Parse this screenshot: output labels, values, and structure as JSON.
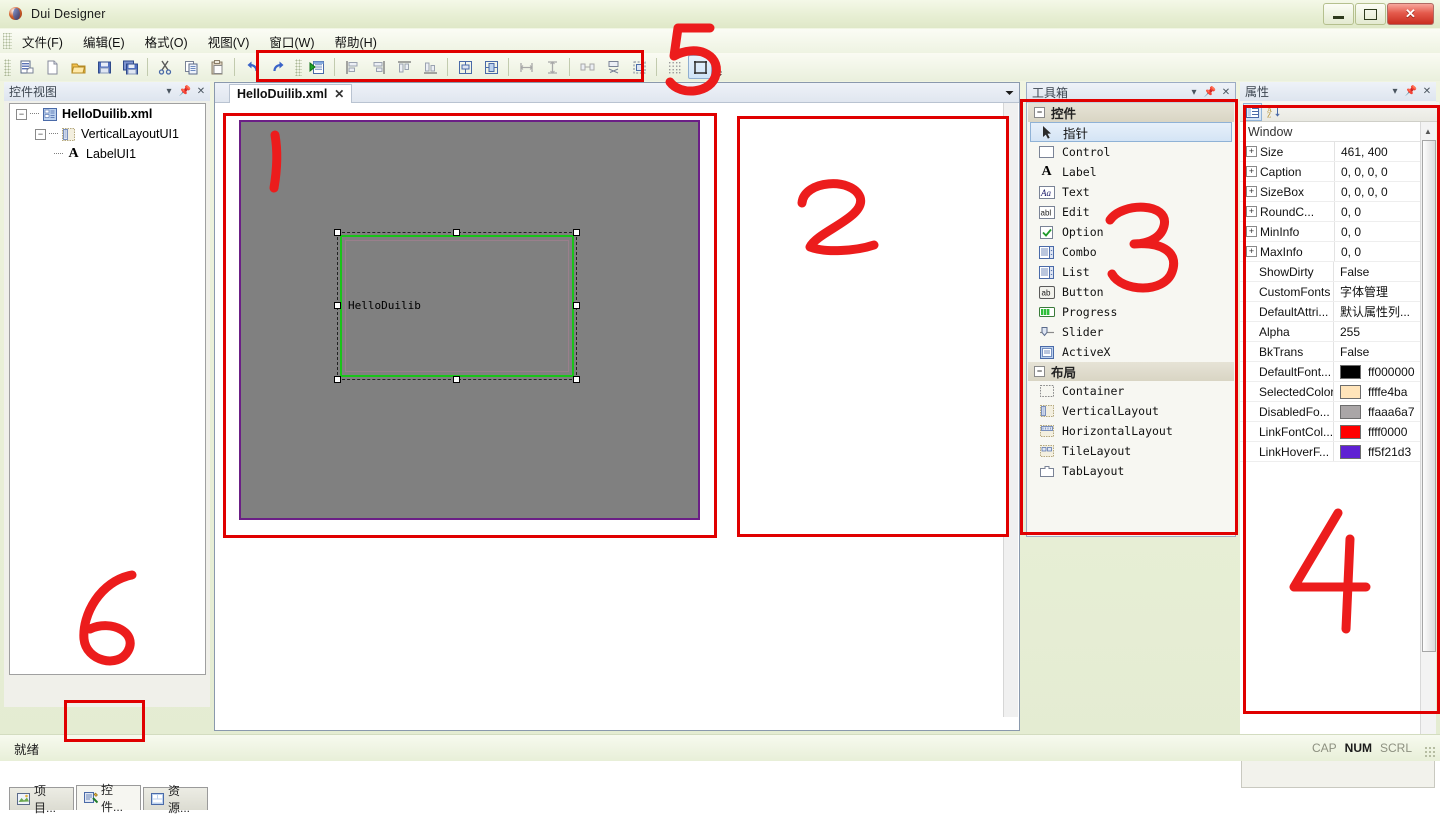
{
  "window": {
    "title": "Dui Designer",
    "app_icon": "dui-app-icon",
    "buttons": {
      "minimize": "minimize-icon",
      "restore": "restore-icon",
      "close": "close-icon"
    }
  },
  "menubar": {
    "items": [
      {
        "label": "文件(F)",
        "name": "menu-file"
      },
      {
        "label": "编辑(E)",
        "name": "menu-edit"
      },
      {
        "label": "格式(O)",
        "name": "menu-format"
      },
      {
        "label": "视图(V)",
        "name": "menu-view"
      },
      {
        "label": "窗口(W)",
        "name": "menu-window"
      },
      {
        "label": "帮助(H)",
        "name": "menu-help"
      }
    ]
  },
  "toolbar": {
    "groups": [
      [
        "new-doc",
        "new-file",
        "open",
        "save",
        "save-all"
      ],
      [
        "cut",
        "copy",
        "paste"
      ],
      [
        "undo",
        "redo"
      ]
    ],
    "format_group": [
      "test-run",
      "align-left",
      "align-right",
      "align-top",
      "align-bottom",
      "center-horizontal",
      "center-vertical",
      "same-width",
      "same-height",
      "space-horizontal",
      "space-vertical",
      "size-to-grid",
      "show-grid",
      "tab-order"
    ],
    "overflow": "toolbar-overflow-chevron"
  },
  "left_panel": {
    "title": "控件视图",
    "header_buttons": [
      "dropdown-icon",
      "pin-icon",
      "close-icon"
    ],
    "tree": [
      {
        "label": "HelloDuilib.xml",
        "level": 1,
        "icon": "xml-document-icon",
        "expanded": true,
        "bold": true
      },
      {
        "label": "VerticalLayoutUI1",
        "level": 2,
        "icon": "vertical-layout-icon",
        "expanded": true,
        "bold": false
      },
      {
        "label": "LabelUI1",
        "level": 3,
        "icon": "label-icon",
        "expanded": false,
        "bold": false
      }
    ],
    "tabs": [
      {
        "label": "项目...",
        "icon": "project-icon",
        "selected": false
      },
      {
        "label": "控件...",
        "icon": "controls-icon",
        "selected": true
      },
      {
        "label": "资源...",
        "icon": "resource-icon",
        "selected": false
      }
    ]
  },
  "editor": {
    "tab": {
      "label": "HelloDuilib.xml",
      "close": "✕"
    },
    "tab_dropdown": "chevron-down-icon",
    "design": {
      "surface_size": "461, 400",
      "selected_control_text": "HelloDuilib",
      "border_color": "#6b1f86",
      "background_color": "#808080",
      "selection_color": "#19c419",
      "handle_count": 8
    }
  },
  "toolbox": {
    "title": "工具箱",
    "header_buttons": [
      "dropdown-icon",
      "pin-icon",
      "close-icon"
    ],
    "categories": [
      {
        "name": "控件",
        "expanded": true,
        "items": [
          {
            "label": "指针",
            "icon": "pointer-icon",
            "selected": true,
            "cn": true
          },
          {
            "label": "Control",
            "icon": "control-icon",
            "selected": false,
            "cn": false
          },
          {
            "label": "Label",
            "icon": "label-a-icon",
            "selected": false,
            "cn": false
          },
          {
            "label": "Text",
            "icon": "text-aa-icon",
            "selected": false,
            "cn": false
          },
          {
            "label": "Edit",
            "icon": "edit-abl-icon",
            "selected": false,
            "cn": false
          },
          {
            "label": "Option",
            "icon": "option-check-icon",
            "selected": false,
            "cn": false
          },
          {
            "label": "Combo",
            "icon": "combo-icon",
            "selected": false,
            "cn": false
          },
          {
            "label": "List",
            "icon": "list-icon",
            "selected": false,
            "cn": false
          },
          {
            "label": "Button",
            "icon": "button-ab-icon",
            "selected": false,
            "cn": false
          },
          {
            "label": "Progress",
            "icon": "progress-icon",
            "selected": false,
            "cn": false
          },
          {
            "label": "Slider",
            "icon": "slider-icon",
            "selected": false,
            "cn": false
          },
          {
            "label": "ActiveX",
            "icon": "activex-icon",
            "selected": false,
            "cn": false
          }
        ]
      },
      {
        "name": "布局",
        "expanded": true,
        "items": [
          {
            "label": "Container",
            "icon": "container-icon",
            "selected": false,
            "cn": false
          },
          {
            "label": "VerticalLayout",
            "icon": "vertical-layout-icon",
            "selected": false,
            "cn": false
          },
          {
            "label": "HorizontalLayout",
            "icon": "horizontal-layout-icon",
            "selected": false,
            "cn": false
          },
          {
            "label": "TileLayout",
            "icon": "tile-layout-icon",
            "selected": false,
            "cn": false
          },
          {
            "label": "TabLayout",
            "icon": "tab-layout-icon",
            "selected": false,
            "cn": false
          }
        ]
      }
    ]
  },
  "properties": {
    "title": "属性",
    "header_buttons": [
      "dropdown-icon",
      "pin-icon",
      "close-icon"
    ],
    "tools": [
      {
        "name": "categorized-button",
        "icon": "categorized-icon",
        "active": true
      },
      {
        "name": "alphabetical-button",
        "icon": "alphabetical-sort-icon",
        "active": false
      }
    ],
    "section": "Window",
    "rows": [
      {
        "name": "Size",
        "value": "461, 400",
        "expandable": true,
        "swatch": null
      },
      {
        "name": "Caption",
        "value": "0, 0, 0, 0",
        "expandable": true,
        "swatch": null
      },
      {
        "name": "SizeBox",
        "value": "0, 0, 0, 0",
        "expandable": true,
        "swatch": null
      },
      {
        "name": "RoundC...",
        "value": "0, 0",
        "expandable": true,
        "swatch": null
      },
      {
        "name": "MinInfo",
        "value": "0, 0",
        "expandable": true,
        "swatch": null
      },
      {
        "name": "MaxInfo",
        "value": "0, 0",
        "expandable": true,
        "swatch": null
      },
      {
        "name": "ShowDirty",
        "value": "False",
        "expandable": false,
        "swatch": null
      },
      {
        "name": "CustomFonts",
        "value": "字体管理",
        "expandable": false,
        "swatch": null
      },
      {
        "name": "DefaultAttri...",
        "value": "默认属性列...",
        "expandable": false,
        "swatch": null
      },
      {
        "name": "Alpha",
        "value": "255",
        "expandable": false,
        "swatch": null
      },
      {
        "name": "BkTrans",
        "value": "False",
        "expandable": false,
        "swatch": null
      },
      {
        "name": "DefaultFont...",
        "value": "ff000000",
        "expandable": false,
        "swatch": "#000000"
      },
      {
        "name": "SelectedColor",
        "value": "ffffe4ba",
        "expandable": false,
        "swatch": "#ffe4ba"
      },
      {
        "name": "DisabledFo...",
        "value": "ffaaa6a7",
        "expandable": false,
        "swatch": "#aaa6a7"
      },
      {
        "name": "LinkFontCol...",
        "value": "ffff0000",
        "expandable": false,
        "swatch": "#ff0000"
      },
      {
        "name": "LinkHoverF...",
        "value": "ff5f21d3",
        "expandable": false,
        "swatch": "#5f21d3"
      }
    ]
  },
  "statusbar": {
    "message": "就绪",
    "indicators": [
      {
        "label": "CAP",
        "active": false
      },
      {
        "label": "NUM",
        "active": true
      },
      {
        "label": "SCRL",
        "active": false
      }
    ]
  },
  "annotations": {
    "color": "#ec1c1c",
    "numbers": [
      {
        "text": "1",
        "name": "annotation-1-design-canvas"
      },
      {
        "text": "2",
        "name": "annotation-2-blank-panel"
      },
      {
        "text": "3",
        "name": "annotation-3-toolbox"
      },
      {
        "text": "4",
        "name": "annotation-4-properties"
      },
      {
        "text": "5",
        "name": "annotation-5-toolbar"
      },
      {
        "text": "6",
        "name": "annotation-6-controls-tab"
      }
    ]
  }
}
